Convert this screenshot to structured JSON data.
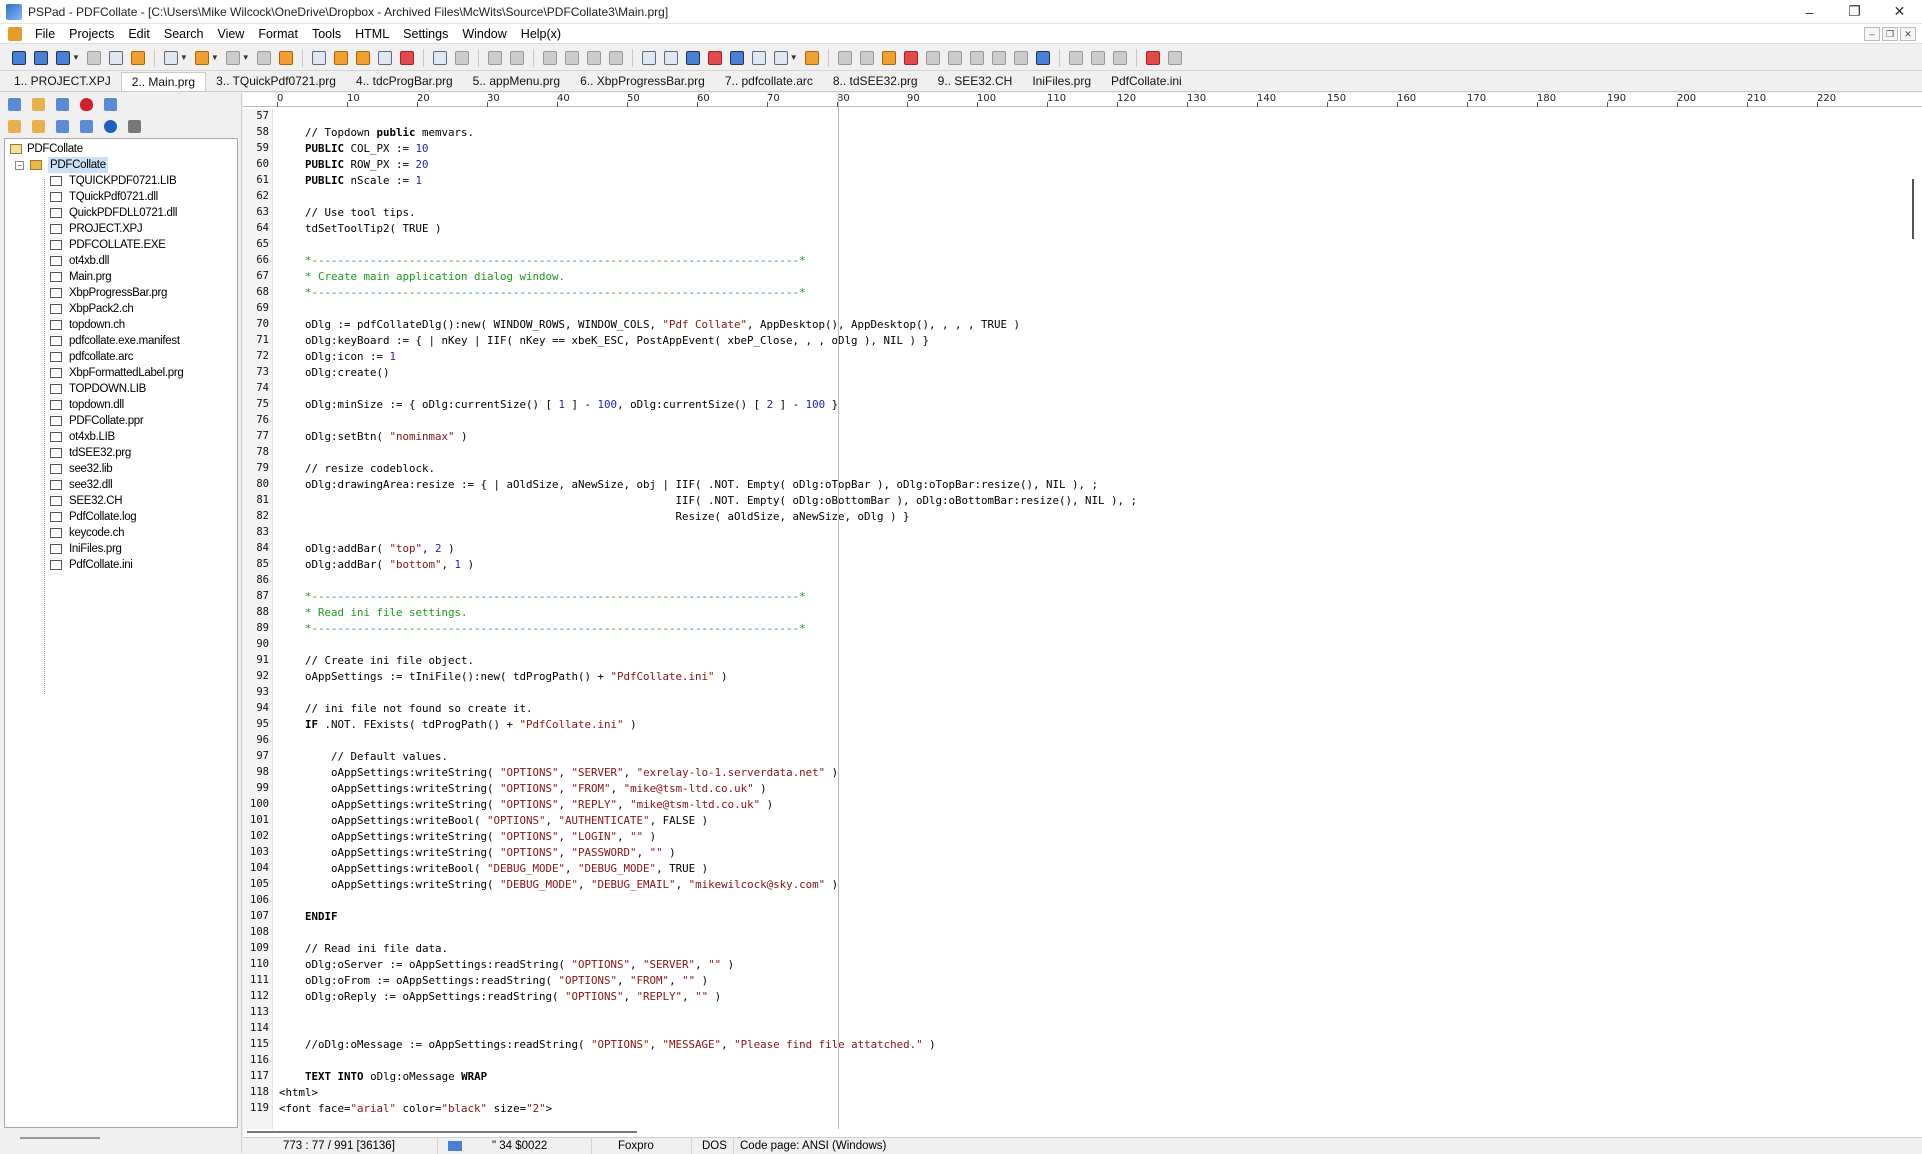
{
  "window": {
    "title": "PSPad - PDFCollate - [C:\\Users\\Mike Wilcock\\OneDrive\\Dropbox - Archived Files\\McWits\\Source\\PDFCollate3\\Main.prg]",
    "controls": [
      "–",
      "❐",
      "✕"
    ]
  },
  "menu": [
    "File",
    "Projects",
    "Edit",
    "Search",
    "View",
    "Format",
    "Tools",
    "HTML",
    "Settings",
    "Window",
    "Help(x)"
  ],
  "tabs": [
    "1.. PROJECT.XPJ",
    "2.. Main.prg",
    "3.. TQuickPdf0721.prg",
    "4.. tdcProgBar.prg",
    "5.. appMenu.prg",
    "6.. XbpProgressBar.prg",
    "7.. pdfcollate.arc",
    "8.. tdSEE32.prg",
    "9.. SEE32.CH",
    "IniFiles.prg",
    "PdfCollate.ini"
  ],
  "active_tab": 1,
  "tree": {
    "root": "PDFCollate",
    "project": "PDFCollate",
    "files": [
      "TQUICKPDF0721.LIB",
      "TQuickPdf0721.dll",
      "QuickPDFDLL0721.dll",
      "PROJECT.XPJ",
      "PDFCOLLATE.EXE",
      "ot4xb.dll",
      "Main.prg",
      "XbpProgressBar.prg",
      "XbpPack2.ch",
      "topdown.ch",
      "pdfcollate.exe.manifest",
      "pdfcollate.arc",
      "XbpFormattedLabel.prg",
      "TOPDOWN.LIB",
      "topdown.dll",
      "PDFCollate.ppr",
      "ot4xb.LIB",
      "tdSEE32.prg",
      "see32.lib",
      "see32.dll",
      "SEE32.CH",
      "PdfCollate.log",
      "keycode.ch",
      "IniFiles.prg",
      "PdfCollate.ini"
    ]
  },
  "ruler": [
    "0",
    "10",
    "20",
    "30",
    "40",
    "50",
    "60",
    "70",
    "80",
    "90",
    "100",
    "110",
    "120",
    "130",
    "140",
    "150",
    "160",
    "170",
    "180",
    "190",
    "200",
    "210",
    "220"
  ],
  "code": [
    {
      "n": "57",
      "t": ""
    },
    {
      "n": "58",
      "t": "    // Topdown public memvars."
    },
    {
      "n": "59",
      "t": "    PUBLIC COL_PX := 10"
    },
    {
      "n": "60",
      "t": "    PUBLIC ROW_PX := 20"
    },
    {
      "n": "61",
      "t": "    PUBLIC nScale := 1"
    },
    {
      "n": "62",
      "t": ""
    },
    {
      "n": "63",
      "t": "    // Use tool tips."
    },
    {
      "n": "64",
      "t": "    tdSetToolTip2( TRUE )"
    },
    {
      "n": "65",
      "t": ""
    },
    {
      "n": "66",
      "t": "    *---------------------------------------------------------------------------*",
      "c": "cg"
    },
    {
      "n": "67",
      "t": "    * Create main application dialog window.",
      "c": "cg"
    },
    {
      "n": "68",
      "t": "    *---------------------------------------------------------------------------*",
      "c": "cg"
    },
    {
      "n": "69",
      "t": ""
    },
    {
      "n": "70",
      "t": "    oDlg := pdfCollateDlg():new( WINDOW_ROWS, WINDOW_COLS, \"Pdf Collate\", AppDesktop(), AppDesktop(), , , , TRUE )"
    },
    {
      "n": "71",
      "t": "    oDlg:keyBoard := { | nKey | IIF( nKey == xbeK_ESC, PostAppEvent( xbeP_Close, , , oDlg ), NIL ) }"
    },
    {
      "n": "72",
      "t": "    oDlg:icon := 1"
    },
    {
      "n": "73",
      "t": "    oDlg:create()"
    },
    {
      "n": "74",
      "t": ""
    },
    {
      "n": "75",
      "t": "    oDlg:minSize := { oDlg:currentSize() [ 1 ] - 100, oDlg:currentSize() [ 2 ] - 100 }"
    },
    {
      "n": "76",
      "t": ""
    },
    {
      "n": "77",
      "t": "    oDlg:setBtn( \"nominmax\" )"
    },
    {
      "n": "78",
      "t": ""
    },
    {
      "n": "79",
      "t": "    // resize codeblock."
    },
    {
      "n": "80",
      "t": "    oDlg:drawingArea:resize := { | aOldSize, aNewSize, obj | IIF( .NOT. Empty( oDlg:oTopBar ), oDlg:oTopBar:resize(), NIL ), ;"
    },
    {
      "n": "81",
      "t": "                                                             IIF( .NOT. Empty( oDlg:oBottomBar ), oDlg:oBottomBar:resize(), NIL ), ;"
    },
    {
      "n": "82",
      "t": "                                                             Resize( aOldSize, aNewSize, oDlg ) }"
    },
    {
      "n": "83",
      "t": ""
    },
    {
      "n": "84",
      "t": "    oDlg:addBar( \"top\", 2 )"
    },
    {
      "n": "85",
      "t": "    oDlg:addBar( \"bottom\", 1 )"
    },
    {
      "n": "86",
      "t": ""
    },
    {
      "n": "87",
      "t": "    *---------------------------------------------------------------------------*",
      "c": "cg"
    },
    {
      "n": "88",
      "t": "    * Read ini file settings.",
      "c": "cg"
    },
    {
      "n": "89",
      "t": "    *---------------------------------------------------------------------------*",
      "c": "cg"
    },
    {
      "n": "90",
      "t": ""
    },
    {
      "n": "91",
      "t": "    // Create ini file object."
    },
    {
      "n": "92",
      "t": "    oAppSettings := tIniFile():new( tdProgPath() + \"PdfCollate.ini\" )"
    },
    {
      "n": "93",
      "t": ""
    },
    {
      "n": "94",
      "t": "    // ini file not found so create it."
    },
    {
      "n": "95",
      "t": "    IF .NOT. FExists( tdProgPath() + \"PdfCollate.ini\" )"
    },
    {
      "n": "96",
      "t": ""
    },
    {
      "n": "97",
      "t": "        // Default values."
    },
    {
      "n": "98",
      "t": "        oAppSettings:writeString( \"OPTIONS\", \"SERVER\", \"exrelay-lo-1.serverdata.net\" )"
    },
    {
      "n": "99",
      "t": "        oAppSettings:writeString( \"OPTIONS\", \"FROM\", \"mike@tsm-ltd.co.uk\" )"
    },
    {
      "n": "100",
      "t": "        oAppSettings:writeString( \"OPTIONS\", \"REPLY\", \"mike@tsm-ltd.co.uk\" )"
    },
    {
      "n": "101",
      "t": "        oAppSettings:writeBool( \"OPTIONS\", \"AUTHENTICATE\", FALSE )"
    },
    {
      "n": "102",
      "t": "        oAppSettings:writeString( \"OPTIONS\", \"LOGIN\", \"\" )"
    },
    {
      "n": "103",
      "t": "        oAppSettings:writeString( \"OPTIONS\", \"PASSWORD\", \"\" )"
    },
    {
      "n": "104",
      "t": "        oAppSettings:writeBool( \"DEBUG_MODE\", \"DEBUG_MODE\", TRUE )"
    },
    {
      "n": "105",
      "t": "        oAppSettings:writeString( \"DEBUG_MODE\", \"DEBUG_EMAIL\", \"mikewilcock@sky.com\" )"
    },
    {
      "n": "106",
      "t": ""
    },
    {
      "n": "107",
      "t": "    ENDIF"
    },
    {
      "n": "108",
      "t": ""
    },
    {
      "n": "109",
      "t": "    // Read ini file data."
    },
    {
      "n": "110",
      "t": "    oDlg:oServer := oAppSettings:readString( \"OPTIONS\", \"SERVER\", \"\" )"
    },
    {
      "n": "111",
      "t": "    oDlg:oFrom := oAppSettings:readString( \"OPTIONS\", \"FROM\", \"\" )"
    },
    {
      "n": "112",
      "t": "    oDlg:oReply := oAppSettings:readString( \"OPTIONS\", \"REPLY\", \"\" )"
    },
    {
      "n": "113",
      "t": ""
    },
    {
      "n": "114",
      "t": ""
    },
    {
      "n": "115",
      "t": "    //oDlg:oMessage := oAppSettings:readString( \"OPTIONS\", \"MESSAGE\", \"Please find file attatched.\" )"
    },
    {
      "n": "116",
      "t": ""
    },
    {
      "n": "117",
      "t": "    TEXT INTO oDlg:oMessage WRAP"
    },
    {
      "n": "118",
      "t": "<html>"
    },
    {
      "n": "119",
      "t": "<font face=\"arial\" color=\"black\" size=\"2\">"
    }
  ],
  "status": {
    "position": "773 : 77 / 991  [36136]",
    "char": "\"   34  $0022",
    "syntax": "Foxpro",
    "eol": "DOS",
    "codepage": "Code page: ANSI (Windows)"
  },
  "colors": {
    "comment": "#1a9c1a",
    "string": "#8b1111",
    "number": "#1f1fbf",
    "selection": "#cce0f7"
  }
}
